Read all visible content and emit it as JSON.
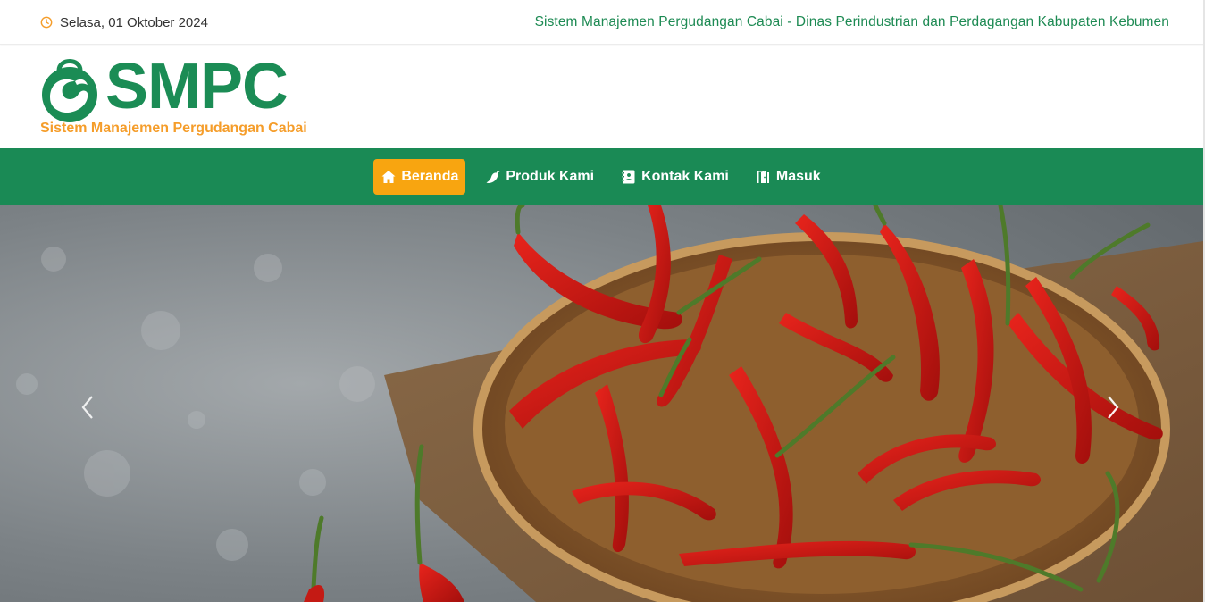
{
  "topbar": {
    "date": "Selasa, 01 Oktober 2024",
    "tagline": "Sistem Manajemen Pergudangan Cabai - Dinas Perindustrian dan Perdagangan Kabupaten Kebumen",
    "clock_icon": "clock-icon"
  },
  "brand": {
    "logo_text": "SMPC",
    "subtitle": "Sistem Manajemen Pergudangan Cabai",
    "primary_color": "#1b8c55",
    "accent_color": "#f59d2a"
  },
  "nav": {
    "items": [
      {
        "label": "Beranda",
        "icon": "home-icon",
        "active": true
      },
      {
        "label": "Produk Kami",
        "icon": "chili-icon",
        "active": false
      },
      {
        "label": "Kontak Kami",
        "icon": "contact-book-icon",
        "active": false
      },
      {
        "label": "Masuk",
        "icon": "door-open-icon",
        "active": false
      }
    ],
    "background": "#1a8a55",
    "active_background": "#f8a510"
  },
  "hero": {
    "image": "basket-of-red-chili-peppers",
    "prev_icon": "chevron-left-icon",
    "next_icon": "chevron-right-icon"
  }
}
